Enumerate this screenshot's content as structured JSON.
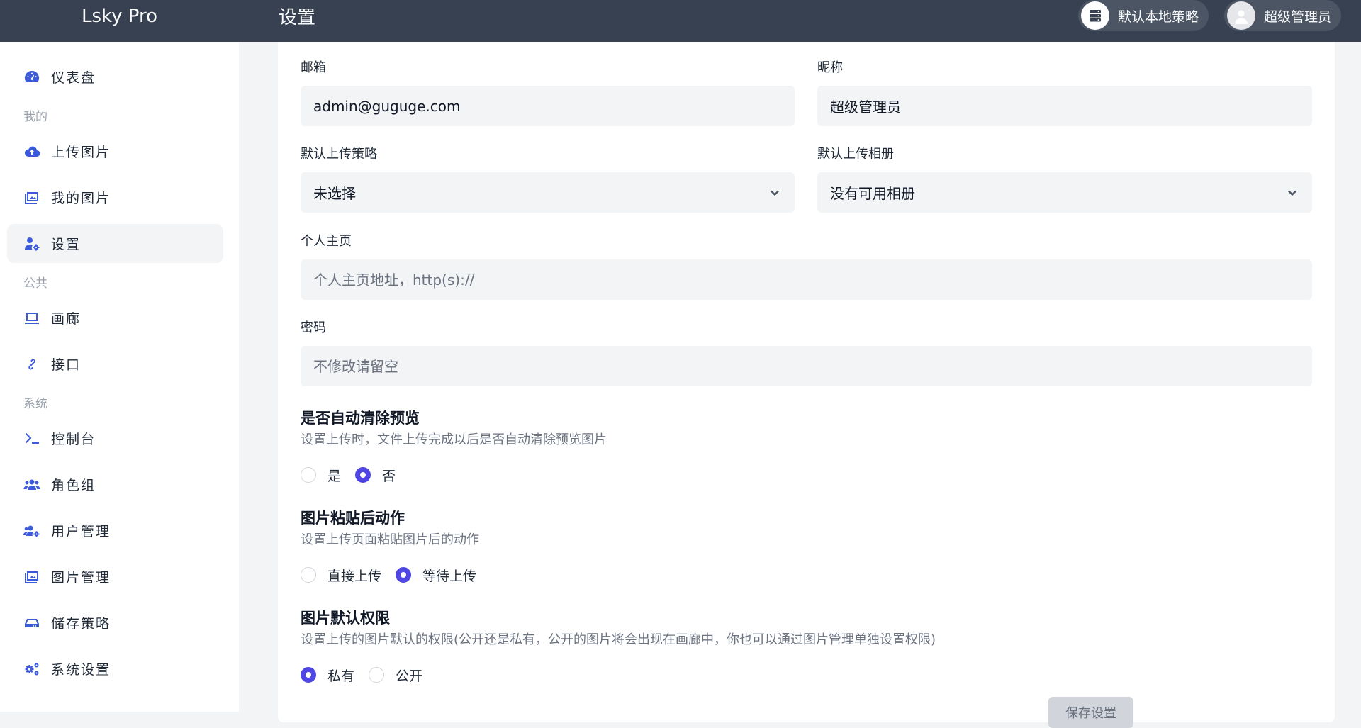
{
  "app": {
    "brand": "Lsky Pro"
  },
  "header": {
    "title": "设置",
    "strategy_label": "默认本地策略",
    "user_label": "超级管理员"
  },
  "sidebar": {
    "dashboard": "仪表盘",
    "section_mine": "我的",
    "upload": "上传图片",
    "my_images": "我的图片",
    "settings": "设置",
    "section_public": "公共",
    "gallery": "画廊",
    "api": "接口",
    "section_system": "系统",
    "console": "控制台",
    "roles": "角色组",
    "users": "用户管理",
    "image_admin": "图片管理",
    "storage": "储存策略",
    "system_settings": "系统设置"
  },
  "form": {
    "email": {
      "label": "邮箱",
      "value": "admin@guguge.com"
    },
    "nickname": {
      "label": "昵称",
      "value": "超级管理员"
    },
    "default_strategy": {
      "label": "默认上传策略",
      "value": "未选择"
    },
    "default_album": {
      "label": "默认上传相册",
      "value": "没有可用相册"
    },
    "homepage": {
      "label": "个人主页",
      "placeholder": "个人主页地址，http(s)://"
    },
    "password": {
      "label": "密码",
      "placeholder": "不修改请留空"
    },
    "auto_clear": {
      "title": "是否自动清除预览",
      "desc": "设置上传时，文件上传完成以后是否自动清除预览图片",
      "options": [
        "是",
        "否"
      ],
      "selected": "否"
    },
    "paste_action": {
      "title": "图片粘贴后动作",
      "desc": "设置上传页面粘贴图片后的动作",
      "options": [
        "直接上传",
        "等待上传"
      ],
      "selected": "等待上传"
    },
    "default_permission": {
      "title": "图片默认权限",
      "desc": "设置上传的图片默认的权限(公开还是私有，公开的图片将会出现在画廊中，你也可以通过图片管理单独设置权限)",
      "options": [
        "私有",
        "公开"
      ],
      "selected": "私有"
    },
    "save_label": "保存设置"
  },
  "colors": {
    "header": "#374151",
    "accent": "#4f46e5",
    "icon": "#3b5bdb"
  }
}
